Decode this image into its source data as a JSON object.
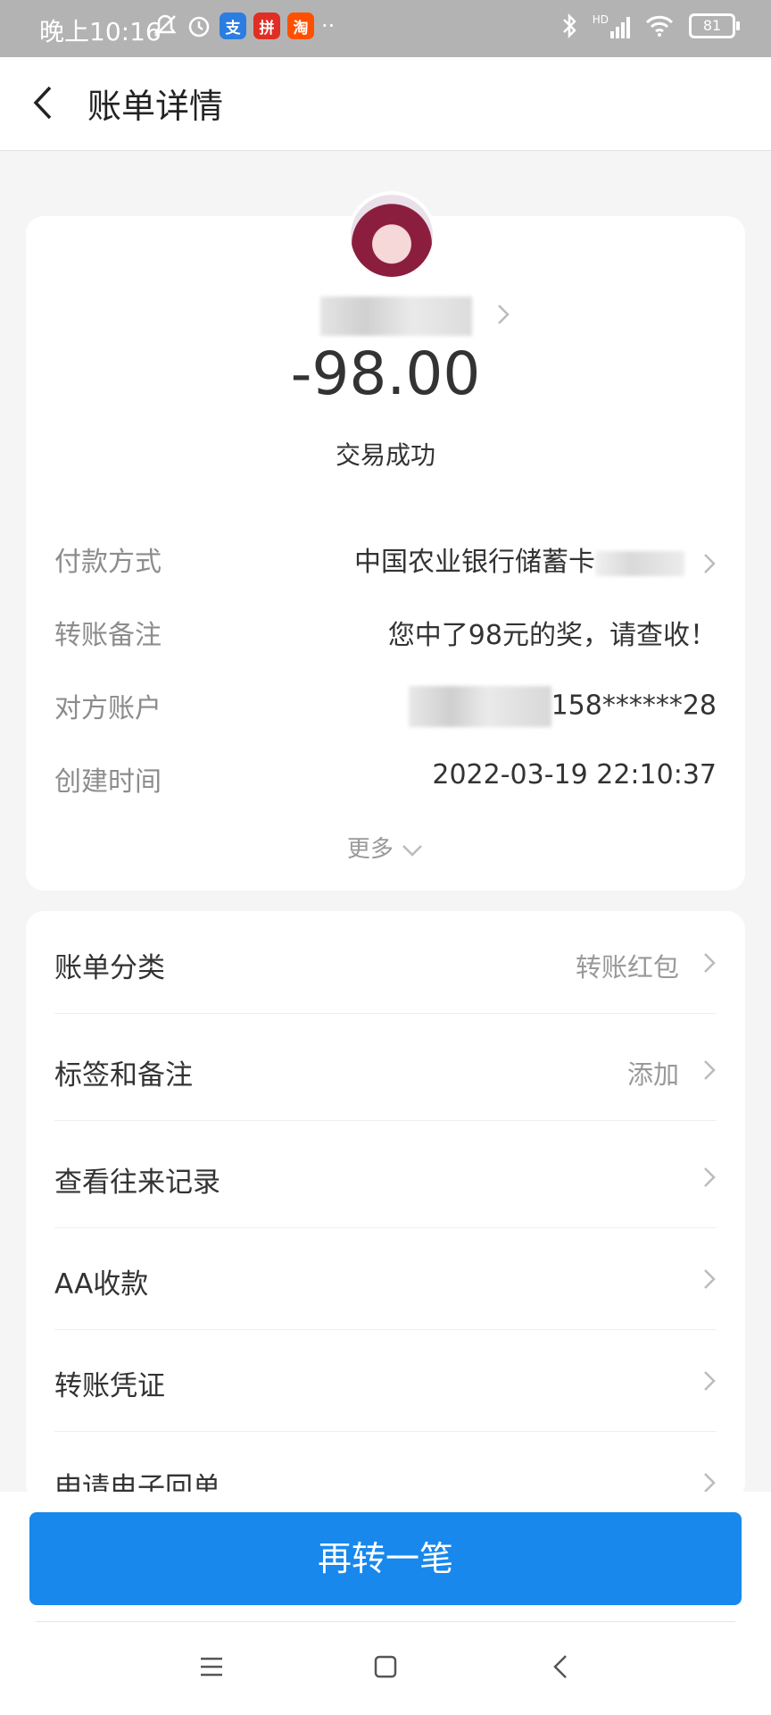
{
  "status_bar": {
    "time": "晚上10:16",
    "app_icons": [
      {
        "name": "alipay-icon",
        "label": "支",
        "color": "#2b7de1"
      },
      {
        "name": "pinduoduo-icon",
        "label": "拼",
        "color": "#e02e24"
      },
      {
        "name": "taobao-icon",
        "label": "淘",
        "color": "#ff5000"
      }
    ],
    "signal": "HD",
    "battery": "81"
  },
  "header": {
    "title": "账单详情"
  },
  "summary": {
    "amount": "-98.00",
    "status": "交易成功"
  },
  "details": [
    {
      "label": "付款方式",
      "value": "中国农业银行储蓄卡"
    },
    {
      "label": "转账备注",
      "value": "您中了98元的奖，请查收！"
    },
    {
      "label": "对方账户",
      "value": "158******28"
    },
    {
      "label": "创建时间",
      "value": "2022-03-19 22:10:37"
    }
  ],
  "more_label": "更多",
  "menu": [
    {
      "label": "账单分类",
      "value": "转账红包"
    },
    {
      "label": "标签和备注",
      "value": "添加"
    },
    {
      "label": "查看往来记录",
      "value": ""
    },
    {
      "label": "AA收款",
      "value": ""
    },
    {
      "label": "转账凭证",
      "value": ""
    },
    {
      "label": "申请电子回单",
      "value": ""
    }
  ],
  "cta_label": "再转一笔",
  "colors": {
    "accent": "#1888ec",
    "background": "#f5f5f5"
  }
}
